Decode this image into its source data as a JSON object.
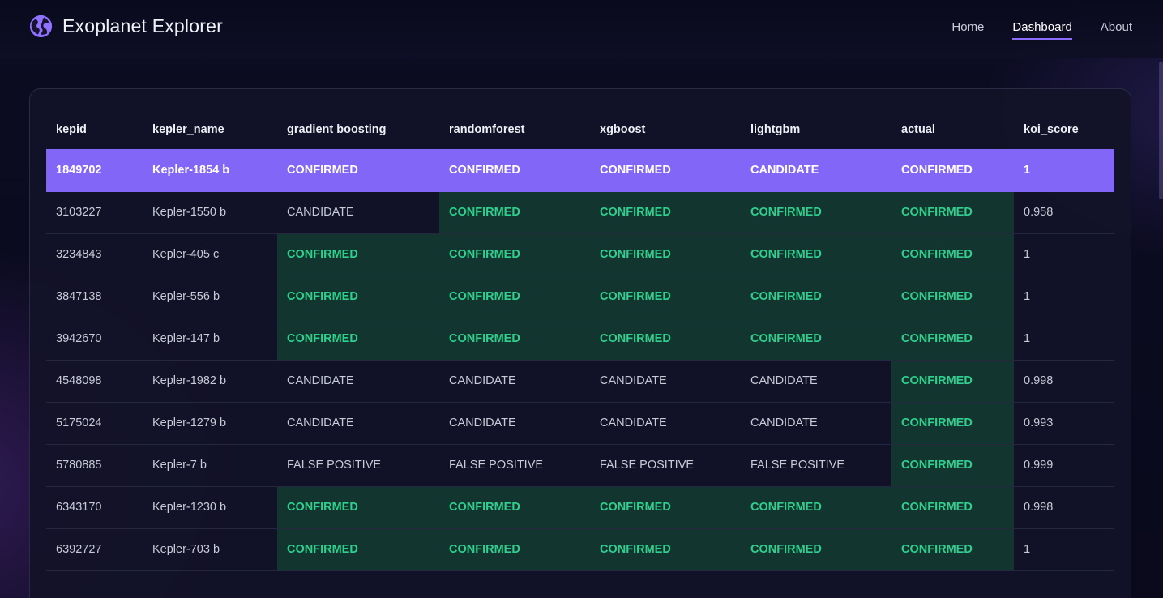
{
  "app": {
    "title": "Exoplanet Explorer"
  },
  "nav": {
    "links": [
      {
        "label": "Home",
        "active": false
      },
      {
        "label": "Dashboard",
        "active": true
      },
      {
        "label": "About",
        "active": false
      }
    ]
  },
  "table": {
    "columns": [
      "kepid",
      "kepler_name",
      "gradient boosting",
      "randomforest",
      "xgboost",
      "lightgbm",
      "actual",
      "koi_score"
    ],
    "selected_row_index": 0,
    "rows": [
      {
        "kepid": "1849702",
        "kepler_name": "Kepler-1854 b",
        "gradient_boosting": "CONFIRMED",
        "randomforest": "CONFIRMED",
        "xgboost": "CONFIRMED",
        "lightgbm": "CANDIDATE",
        "actual": "CONFIRMED",
        "koi_score": "1"
      },
      {
        "kepid": "3103227",
        "kepler_name": "Kepler-1550 b",
        "gradient_boosting": "CANDIDATE",
        "randomforest": "CONFIRMED",
        "xgboost": "CONFIRMED",
        "lightgbm": "CONFIRMED",
        "actual": "CONFIRMED",
        "koi_score": "0.958"
      },
      {
        "kepid": "3234843",
        "kepler_name": "Kepler-405 c",
        "gradient_boosting": "CONFIRMED",
        "randomforest": "CONFIRMED",
        "xgboost": "CONFIRMED",
        "lightgbm": "CONFIRMED",
        "actual": "CONFIRMED",
        "koi_score": "1"
      },
      {
        "kepid": "3847138",
        "kepler_name": "Kepler-556 b",
        "gradient_boosting": "CONFIRMED",
        "randomforest": "CONFIRMED",
        "xgboost": "CONFIRMED",
        "lightgbm": "CONFIRMED",
        "actual": "CONFIRMED",
        "koi_score": "1"
      },
      {
        "kepid": "3942670",
        "kepler_name": "Kepler-147 b",
        "gradient_boosting": "CONFIRMED",
        "randomforest": "CONFIRMED",
        "xgboost": "CONFIRMED",
        "lightgbm": "CONFIRMED",
        "actual": "CONFIRMED",
        "koi_score": "1"
      },
      {
        "kepid": "4548098",
        "kepler_name": "Kepler-1982 b",
        "gradient_boosting": "CANDIDATE",
        "randomforest": "CANDIDATE",
        "xgboost": "CANDIDATE",
        "lightgbm": "CANDIDATE",
        "actual": "CONFIRMED",
        "koi_score": "0.998"
      },
      {
        "kepid": "5175024",
        "kepler_name": "Kepler-1279 b",
        "gradient_boosting": "CANDIDATE",
        "randomforest": "CANDIDATE",
        "xgboost": "CANDIDATE",
        "lightgbm": "CANDIDATE",
        "actual": "CONFIRMED",
        "koi_score": "0.993"
      },
      {
        "kepid": "5780885",
        "kepler_name": "Kepler-7 b",
        "gradient_boosting": "FALSE POSITIVE",
        "randomforest": "FALSE POSITIVE",
        "xgboost": "FALSE POSITIVE",
        "lightgbm": "FALSE POSITIVE",
        "actual": "CONFIRMED",
        "koi_score": "0.999"
      },
      {
        "kepid": "6343170",
        "kepler_name": "Kepler-1230 b",
        "gradient_boosting": "CONFIRMED",
        "randomforest": "CONFIRMED",
        "xgboost": "CONFIRMED",
        "lightgbm": "CONFIRMED",
        "actual": "CONFIRMED",
        "koi_score": "0.998"
      },
      {
        "kepid": "6392727",
        "kepler_name": "Kepler-703 b",
        "gradient_boosting": "CONFIRMED",
        "randomforest": "CONFIRMED",
        "xgboost": "CONFIRMED",
        "lightgbm": "CONFIRMED",
        "actual": "CONFIRMED",
        "koi_score": "1"
      }
    ]
  },
  "colors": {
    "accent": "#8266f7",
    "confirmed_text": "#2fd08e",
    "confirmed_cell_bg": "#133530",
    "background": "#0b0b1f"
  },
  "icons": {
    "brand": "globe-icon"
  }
}
